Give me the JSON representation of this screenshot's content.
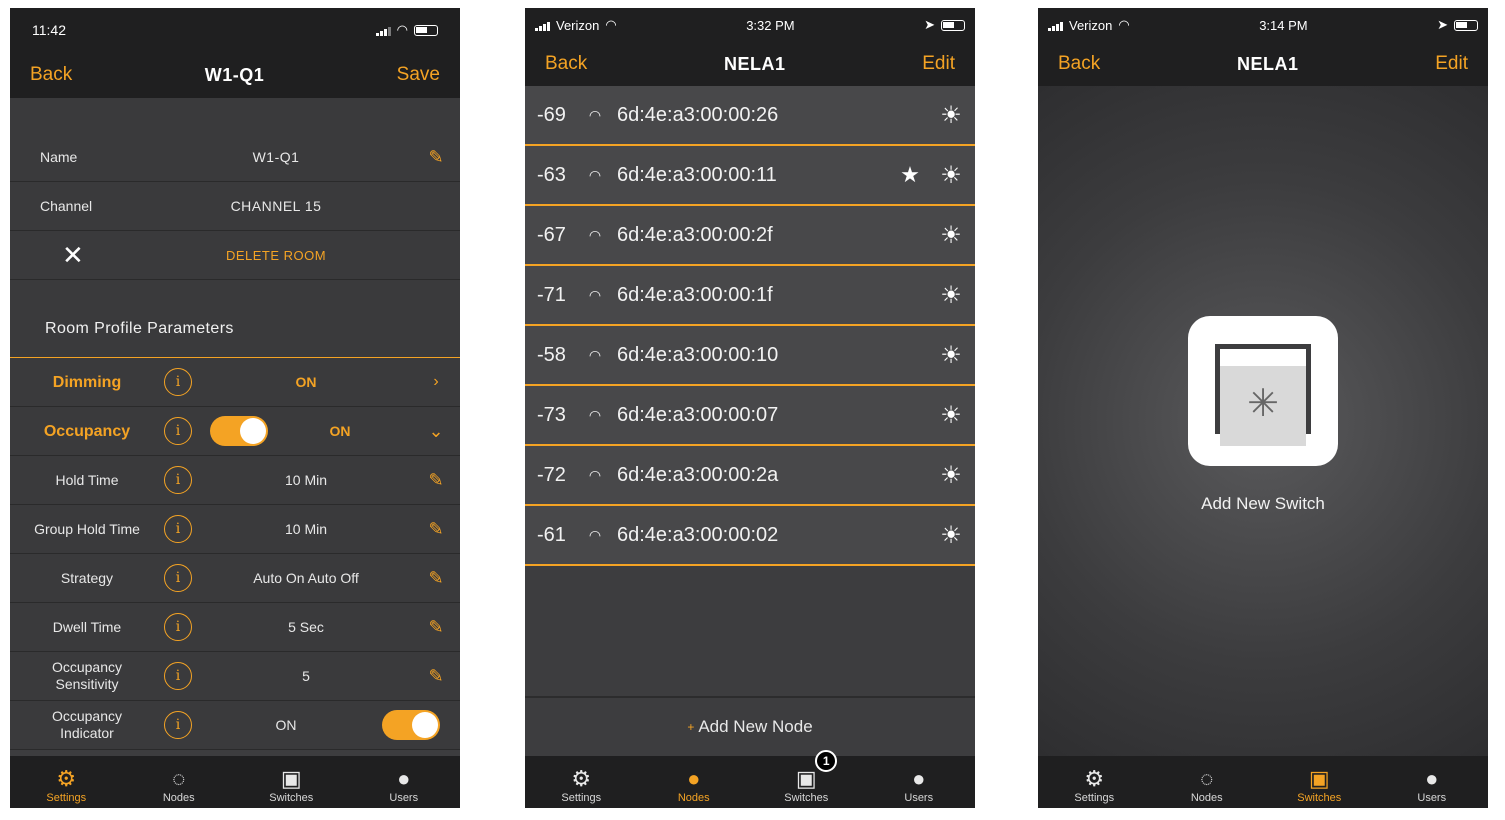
{
  "screen1": {
    "status_time": "11:42",
    "nav": {
      "back": "Back",
      "title": "W1-Q1",
      "action": "Save"
    },
    "name_label": "Name",
    "name_value": "W1-Q1",
    "channel_label": "Channel",
    "channel_value": "CHANNEL 15",
    "delete_label": "DELETE ROOM",
    "section_title": "Room Profile Parameters",
    "params": [
      {
        "label": "Dimming",
        "value": "ON"
      },
      {
        "label": "Occupancy",
        "value": "ON"
      },
      {
        "label": "Hold Time",
        "value": "10 Min"
      },
      {
        "label": "Group Hold Time",
        "value": "10 Min"
      },
      {
        "label": "Strategy",
        "value": "Auto On Auto Off"
      },
      {
        "label": "Dwell Time",
        "value": "5 Sec"
      },
      {
        "label": "Occupancy Sensitivity",
        "value": "5"
      },
      {
        "label": "Occupancy Indicator",
        "value": "ON"
      }
    ],
    "info_glyph": "i",
    "tabs": [
      "Settings",
      "Nodes",
      "Switches",
      "Users"
    ]
  },
  "screen2": {
    "carrier": "Verizon",
    "status_time": "3:32 PM",
    "nav": {
      "back": "Back",
      "title": "NELA1",
      "action": "Edit"
    },
    "nodes": [
      {
        "rssi": "-69",
        "mac": "6d:4e:a3:00:00:26",
        "star": ""
      },
      {
        "rssi": "-63",
        "mac": "6d:4e:a3:00:00:11",
        "star": "★"
      },
      {
        "rssi": "-67",
        "mac": "6d:4e:a3:00:00:2f",
        "star": ""
      },
      {
        "rssi": "-71",
        "mac": "6d:4e:a3:00:00:1f",
        "star": ""
      },
      {
        "rssi": "-58",
        "mac": "6d:4e:a3:00:00:10",
        "star": ""
      },
      {
        "rssi": "-73",
        "mac": "6d:4e:a3:00:00:07",
        "star": ""
      },
      {
        "rssi": "-72",
        "mac": "6d:4e:a3:00:00:2a",
        "star": ""
      },
      {
        "rssi": "-61",
        "mac": "6d:4e:a3:00:00:02",
        "star": ""
      }
    ],
    "add_node": "Add New Node",
    "switch_badge": "1",
    "tabs": [
      "Settings",
      "Nodes",
      "Switches",
      "Users"
    ]
  },
  "screen3": {
    "carrier": "Verizon",
    "status_time": "3:14 PM",
    "nav": {
      "back": "Back",
      "title": "NELA1",
      "action": "Edit"
    },
    "add_switch": "Add New Switch",
    "tabs": [
      "Settings",
      "Nodes",
      "Switches",
      "Users"
    ]
  },
  "icons": {
    "settings": "settings-gear-icon",
    "nodes": "bulb-icon",
    "switches": "switch-icon",
    "users": "user-icon",
    "wifi": "wifi-icon",
    "sun": "light-icon",
    "edit": "pencil-icon"
  },
  "colors": {
    "accent": "#f4a324",
    "bar": "#1f1f20",
    "background": "#3d3d3f"
  }
}
